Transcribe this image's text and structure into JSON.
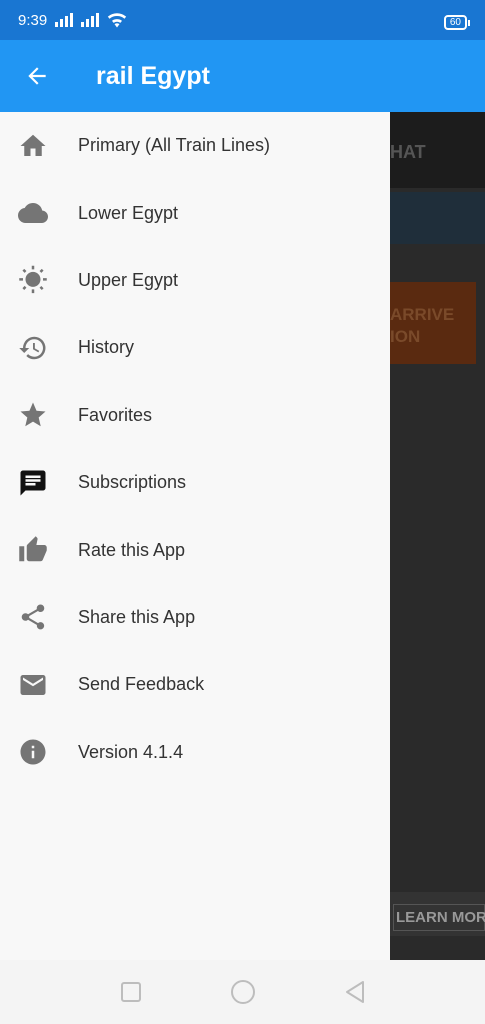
{
  "status_bar": {
    "time": "9:39",
    "battery": "60"
  },
  "app_bar": {
    "title": "rail Egypt"
  },
  "background": {
    "header_text": "HAT",
    "banner_text": "ARRIVE ION",
    "learn_more": "LEARN MORE"
  },
  "drawer": {
    "items": [
      {
        "label": "Primary (All Train Lines)",
        "icon": "home-icon"
      },
      {
        "label": "Lower Egypt",
        "icon": "cloud-icon"
      },
      {
        "label": "Upper Egypt",
        "icon": "sun-icon"
      },
      {
        "label": "History",
        "icon": "history-icon"
      },
      {
        "label": "Favorites",
        "icon": "star-icon"
      },
      {
        "label": "Subscriptions",
        "icon": "message-icon"
      },
      {
        "label": "Rate this App",
        "icon": "thumb-up-icon"
      },
      {
        "label": "Share this App",
        "icon": "share-icon"
      },
      {
        "label": "Send Feedback",
        "icon": "mail-icon"
      },
      {
        "label": "Version 4.1.4",
        "icon": "info-icon"
      }
    ]
  },
  "colors": {
    "status_bar": "#1976d2",
    "app_bar": "#2196f3",
    "drawer_bg": "#f8f8f8",
    "icon": "#757575"
  }
}
